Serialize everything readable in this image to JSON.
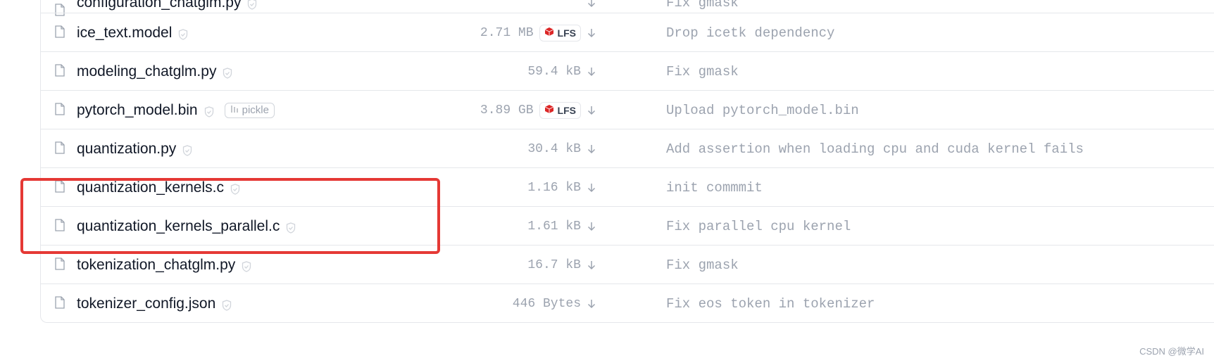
{
  "files": [
    {
      "name": "configuration_chatglm.py",
      "size": "",
      "lfs": false,
      "pickle": false,
      "commit": "Fix gmask"
    },
    {
      "name": "ice_text.model",
      "size": "2.71 MB",
      "lfs": true,
      "pickle": false,
      "commit": "Drop icetk dependency"
    },
    {
      "name": "modeling_chatglm.py",
      "size": "59.4 kB",
      "lfs": false,
      "pickle": false,
      "commit": "Fix gmask"
    },
    {
      "name": "pytorch_model.bin",
      "size": "3.89 GB",
      "lfs": true,
      "pickle": true,
      "commit": "Upload pytorch_model.bin"
    },
    {
      "name": "quantization.py",
      "size": "30.4 kB",
      "lfs": false,
      "pickle": false,
      "commit": "Add assertion when loading cpu and cuda kernel fails"
    },
    {
      "name": "quantization_kernels.c",
      "size": "1.16 kB",
      "lfs": false,
      "pickle": false,
      "commit": "init commmit"
    },
    {
      "name": "quantization_kernels_parallel.c",
      "size": "1.61 kB",
      "lfs": false,
      "pickle": false,
      "commit": "Fix parallel cpu kernel"
    },
    {
      "name": "tokenization_chatglm.py",
      "size": "16.7 kB",
      "lfs": false,
      "pickle": false,
      "commit": "Fix gmask"
    },
    {
      "name": "tokenizer_config.json",
      "size": "446 Bytes",
      "lfs": false,
      "pickle": false,
      "commit": "Fix eos token in tokenizer"
    }
  ],
  "badges": {
    "lfs_label": "LFS",
    "pickle_label": "pickle"
  },
  "colors": {
    "highlight": "#e53935",
    "lfs_icon": "#dc2626",
    "muted": "#9ca3af"
  },
  "watermark": "CSDN @微学AI"
}
